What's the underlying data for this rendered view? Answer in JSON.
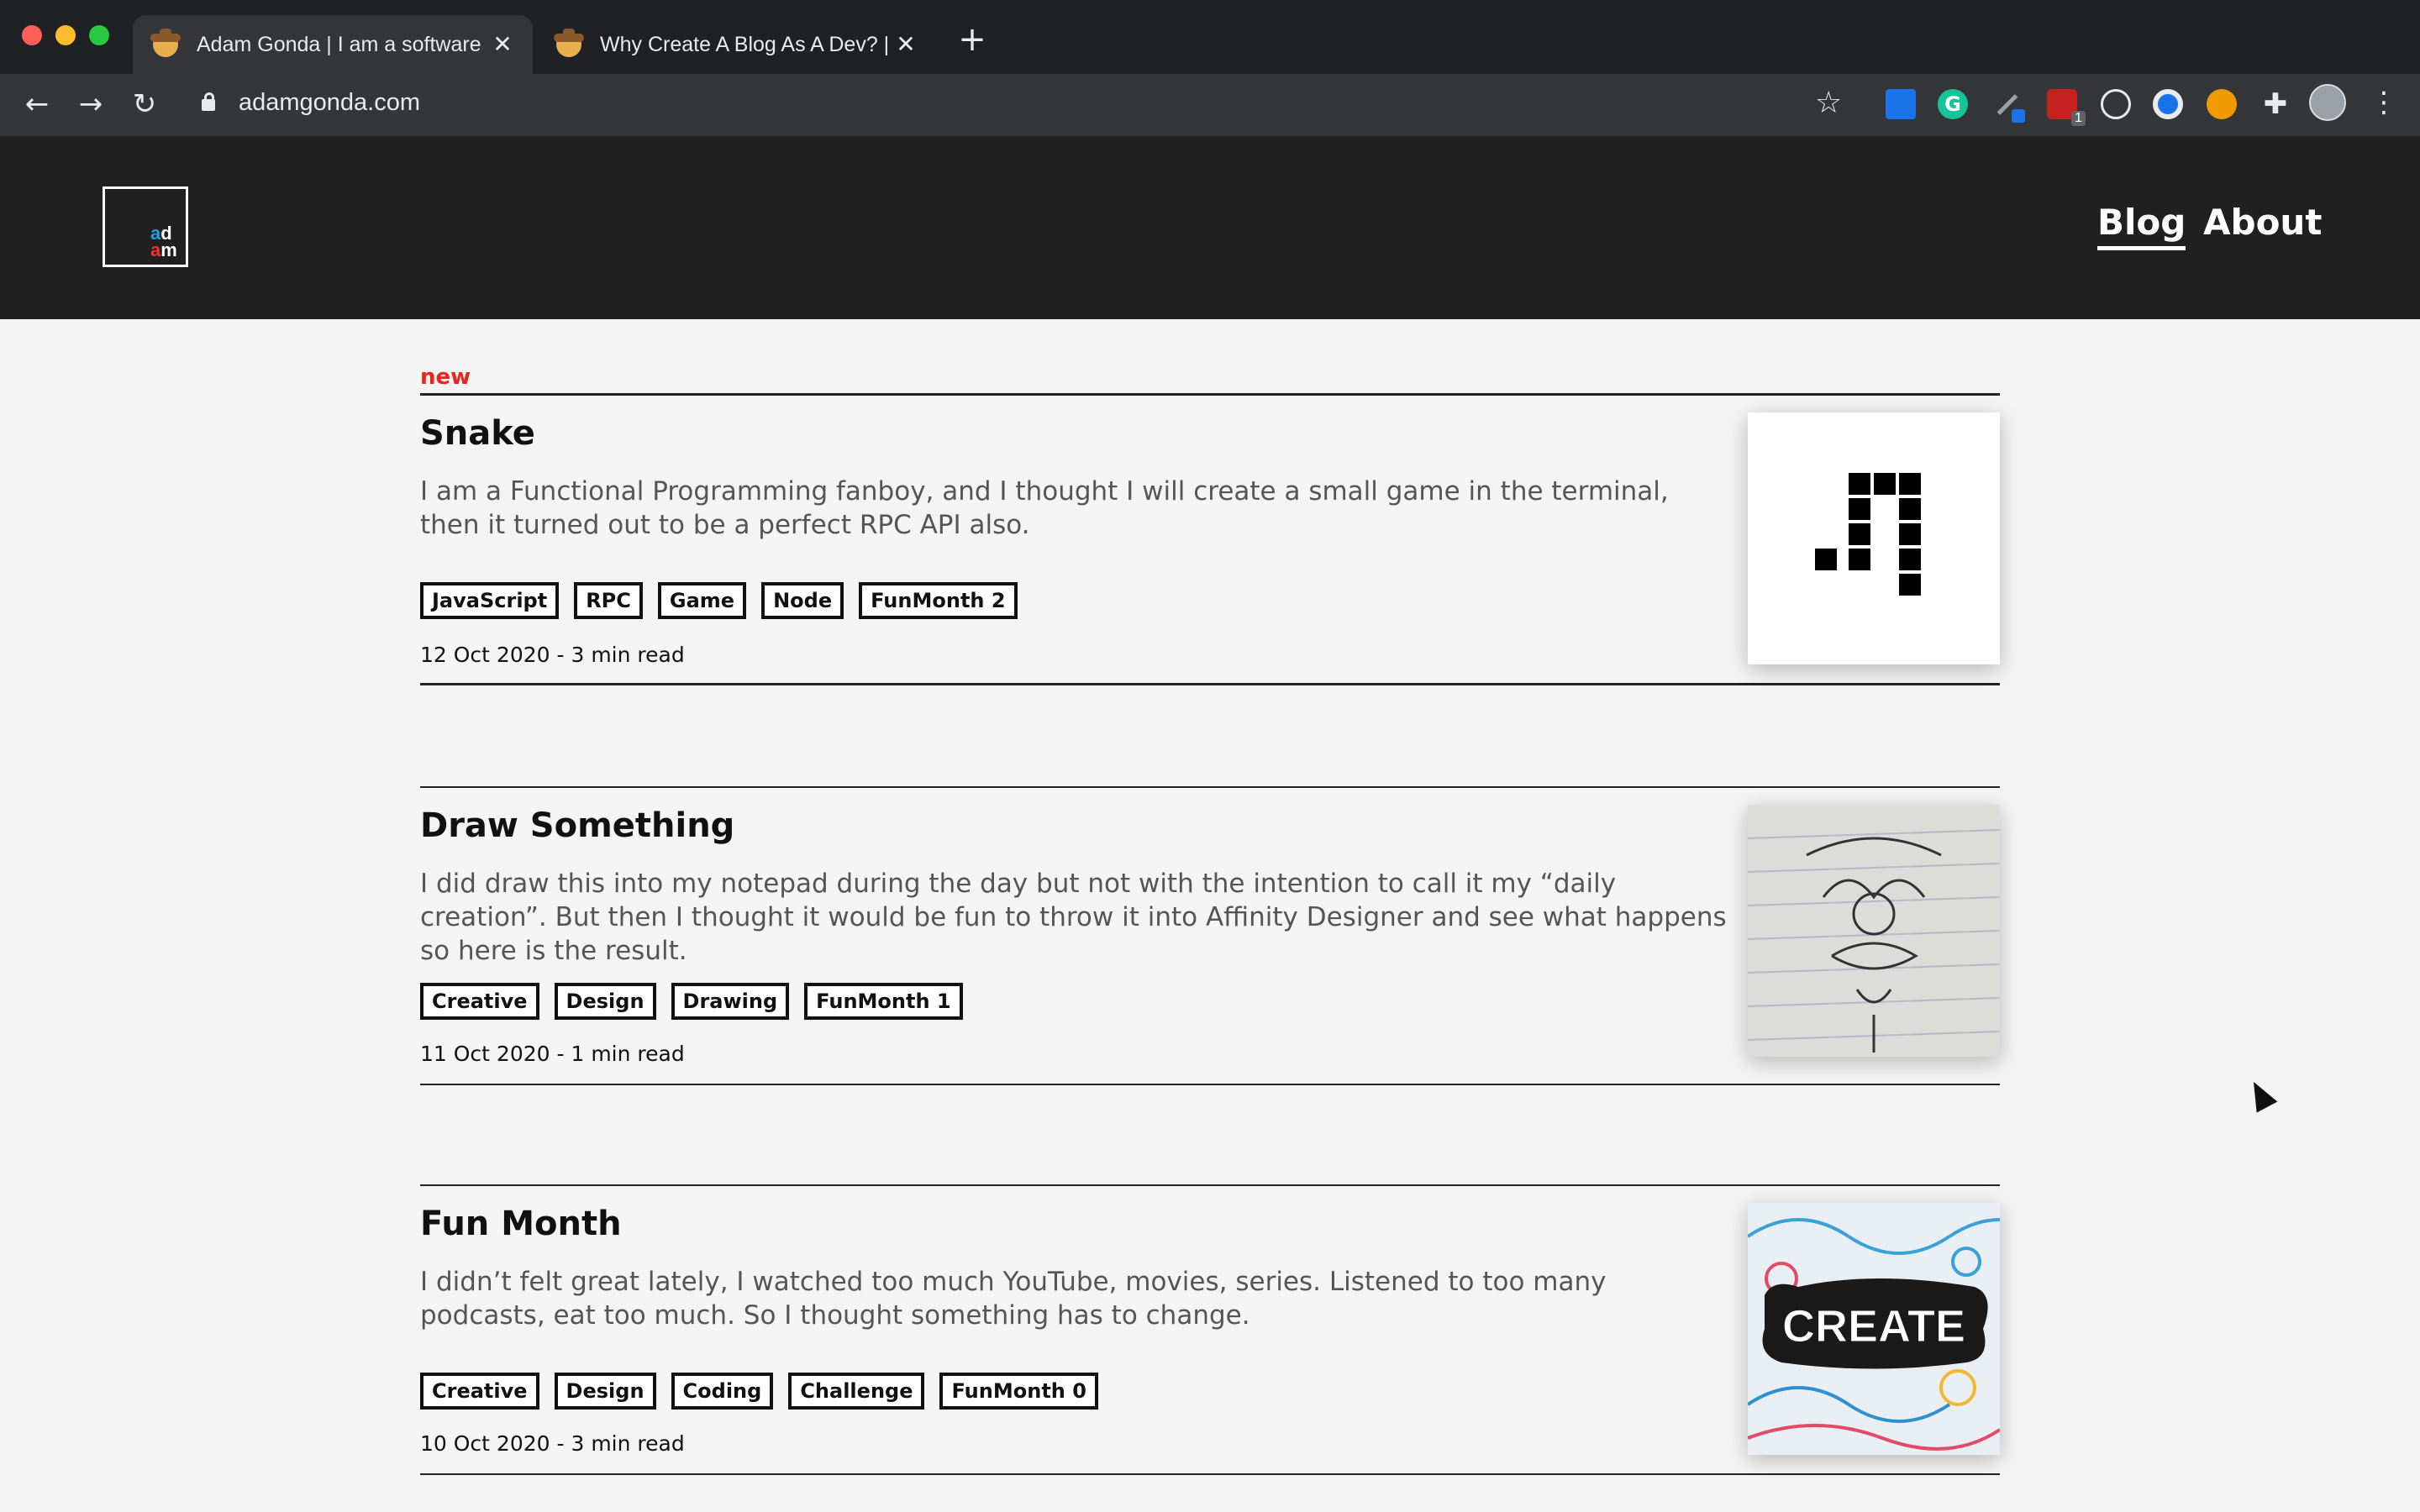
{
  "browser": {
    "tabs": [
      {
        "title": "Adam Gonda | I am a software"
      },
      {
        "title": "Why Create A Blog As A Dev? |"
      }
    ],
    "new_tab_label": "+",
    "url": "adamgonda.com",
    "extension_badge": "1",
    "extension_g_label": "G"
  },
  "site": {
    "logo": {
      "line1_a": "a",
      "line1_b": "d",
      "line2_a": "a",
      "line2_b": "m"
    },
    "nav": {
      "blog": "Blog",
      "about": "About"
    }
  },
  "new_label": "new",
  "posts": [
    {
      "title": "Snake",
      "excerpt": "I am a Functional Programming fanboy, and I thought I will create a small game in the terminal, then it turned out to be a perfect RPC API also.",
      "tags": [
        "JavaScript",
        "RPC",
        "Game",
        "Node",
        "FunMonth 2"
      ],
      "meta": "12 Oct 2020 - 3 min read"
    },
    {
      "title": "Draw Something",
      "excerpt": "I did draw this into my notepad during the day but not with the intention to call it my “daily creation”. But then I thought it would be fun to throw it into Affinity Designer and see what happens so here is the result.",
      "tags": [
        "Creative",
        "Design",
        "Drawing",
        "FunMonth 1"
      ],
      "meta": "11 Oct 2020 - 1 min read"
    },
    {
      "title": "Fun Month",
      "excerpt": "I didn’t felt great lately, I watched too much YouTube, movies, series. Listened to too many podcasts, eat too much. So I thought something has to change.",
      "tags": [
        "Creative",
        "Design",
        "Coding",
        "Challenge",
        "FunMonth 0"
      ],
      "meta": "10 Oct 2020 - 3 min read",
      "thumb_text": "CREATE"
    }
  ],
  "colors": {
    "header_bg": "#202020",
    "page_bg": "#f4f4f4",
    "new_label": "#e8241c",
    "logo_blue": "#1ba0e2",
    "logo_red": "#ff2d2d"
  }
}
